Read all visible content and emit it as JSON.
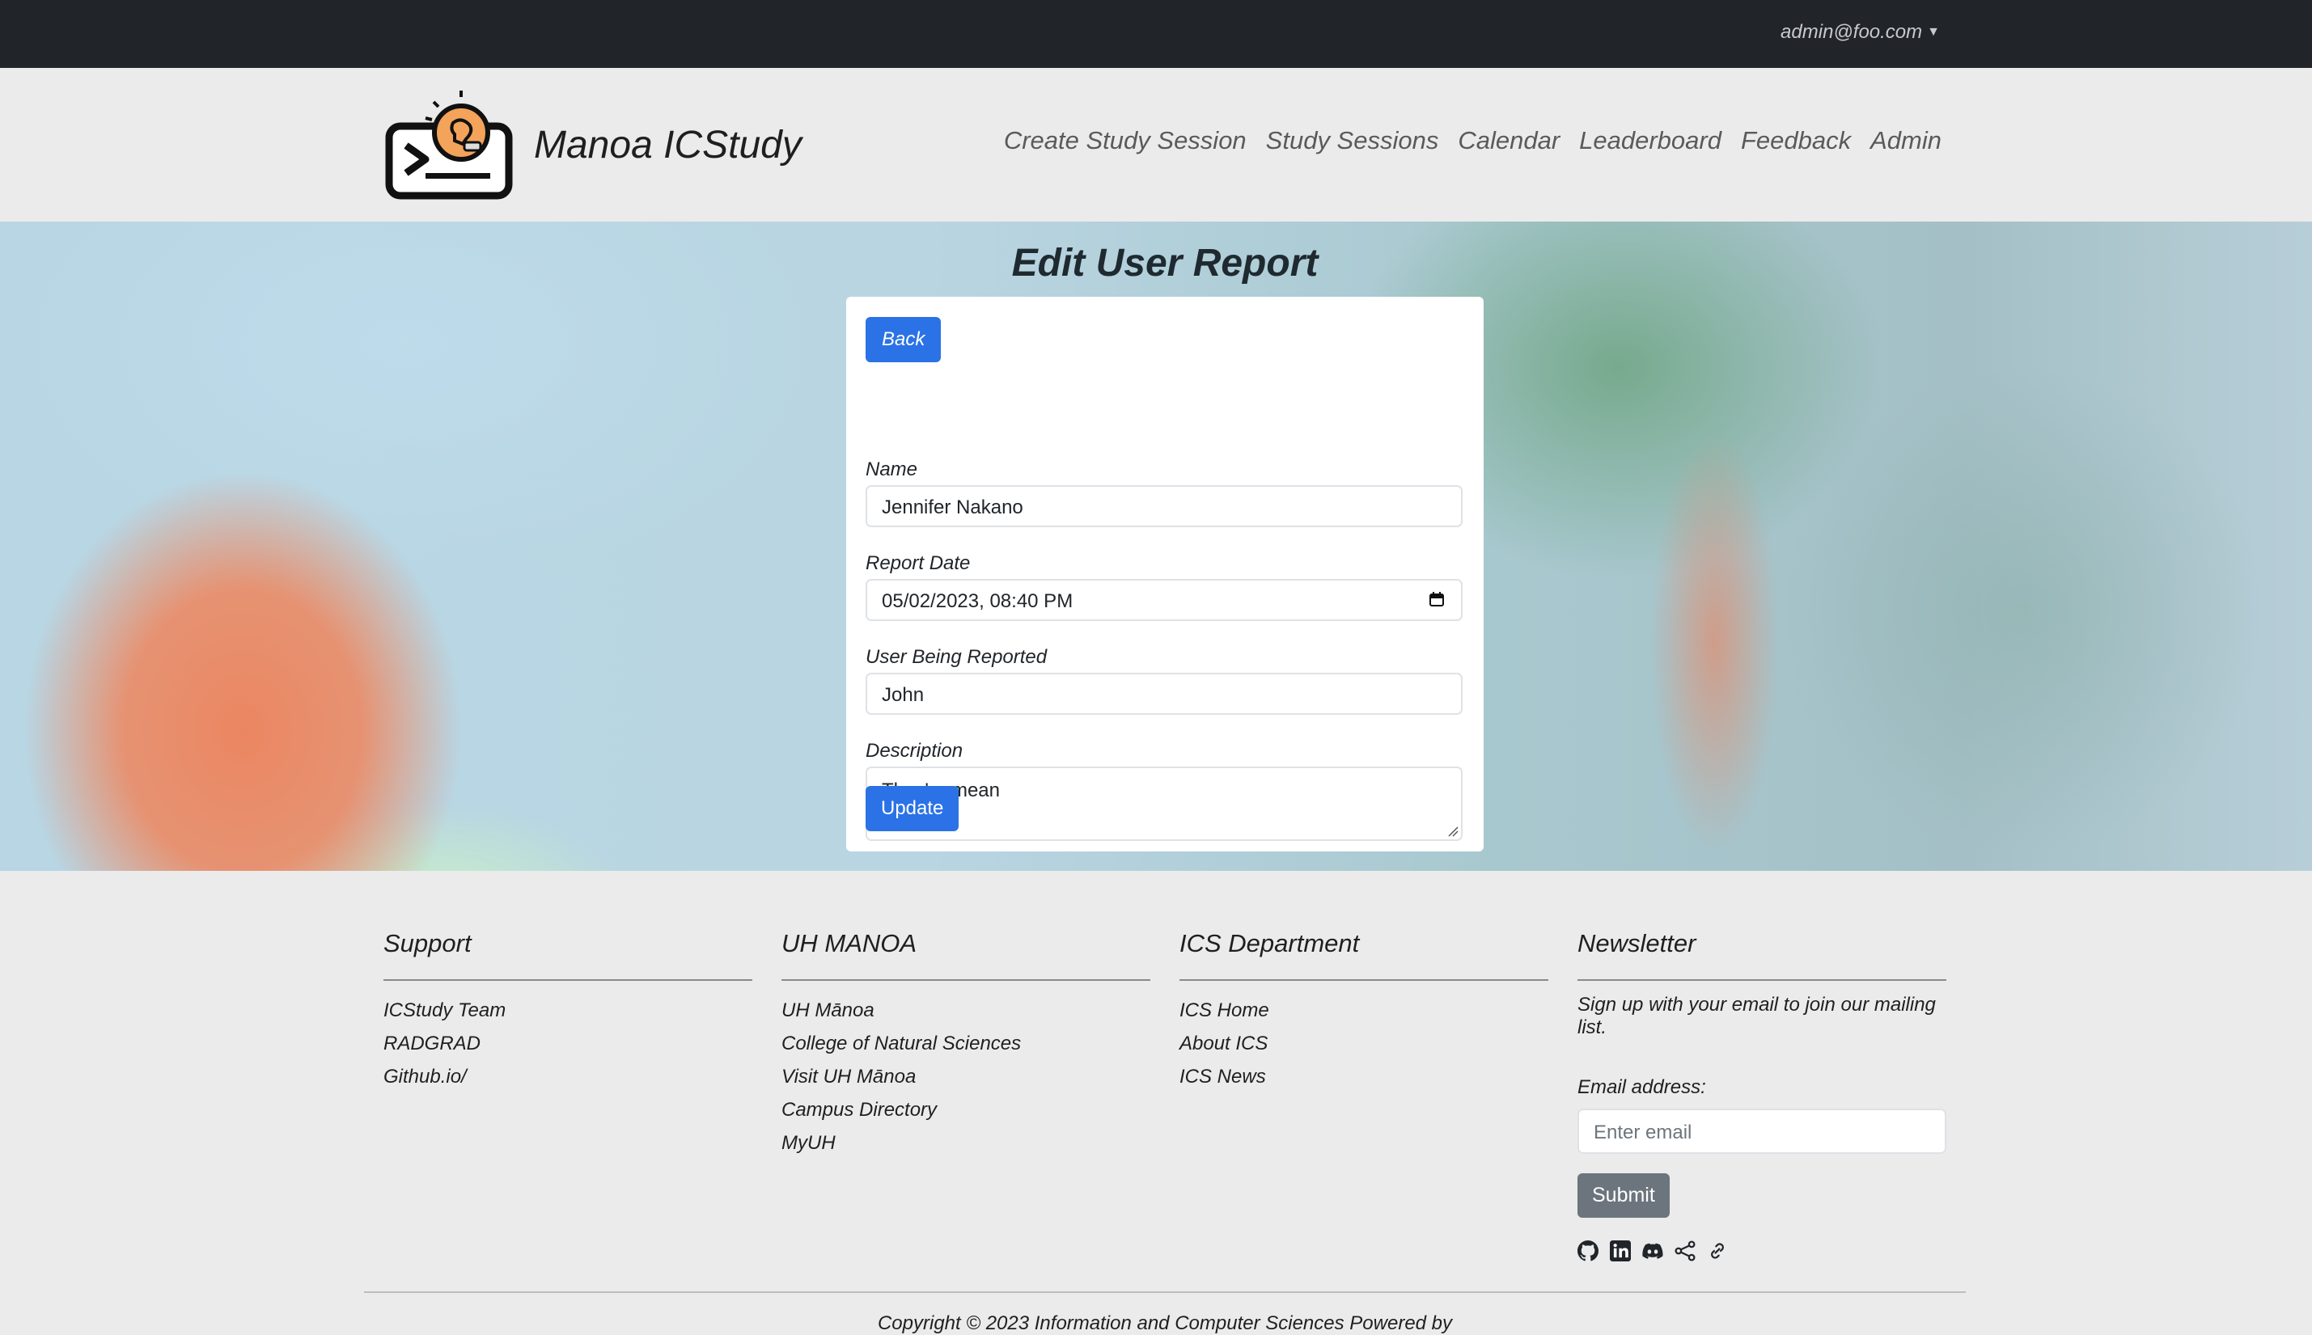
{
  "topbar": {
    "user_email": "admin@foo.com"
  },
  "navbar": {
    "brand": "Manoa ICStudy",
    "links": [
      "Create Study Session",
      "Study Sessions",
      "Calendar",
      "Leaderboard",
      "Feedback",
      "Admin"
    ]
  },
  "page": {
    "title": "Edit User Report"
  },
  "form": {
    "back_label": "Back",
    "name_label": "Name",
    "name_value": "Jennifer Nakano",
    "date_label": "Report Date",
    "date_value": "05/02/2023, 08:40 PM",
    "reported_label": "User Being Reported",
    "reported_value": "John",
    "description_label": "Description",
    "description_value": "They're mean",
    "update_label": "Update"
  },
  "footer": {
    "support": {
      "heading": "Support",
      "links": [
        "ICStudy Team",
        "RADGRAD",
        "Github.io/"
      ]
    },
    "uh": {
      "heading": "UH MANOA",
      "links": [
        "UH Mānoa",
        "College of Natural Sciences",
        "Visit UH Mānoa",
        "Campus Directory",
        "MyUH"
      ]
    },
    "ics": {
      "heading": "ICS Department",
      "links": [
        "ICS Home",
        "About ICS",
        "ICS News"
      ]
    },
    "newsletter": {
      "heading": "Newsletter",
      "text": "Sign up with your email to join our mailing list.",
      "email_label": "Email address:",
      "email_placeholder": "Enter email",
      "submit_label": "Submit"
    },
    "social_icons": [
      "github-icon",
      "linkedin-icon",
      "discord-icon",
      "share-icon",
      "link-icon"
    ],
    "copyright": "Copyright © 2023 Information and Computer Sciences    Powered by"
  }
}
